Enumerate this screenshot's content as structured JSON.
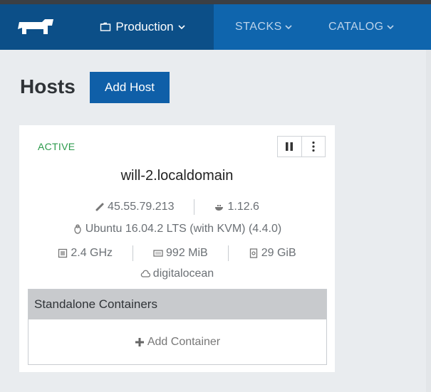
{
  "nav": {
    "environment": "Production",
    "items": [
      "STACKS",
      "CATALOG"
    ]
  },
  "page": {
    "title": "Hosts",
    "add_host_label": "Add Host"
  },
  "host": {
    "state": "ACTIVE",
    "name": "will-2.localdomain",
    "ip": "45.55.79.213",
    "docker_version": "1.12.6",
    "os": "Ubuntu 16.04.2 LTS (with KVM) (4.4.0)",
    "cpu": "2.4 GHz",
    "memory": "992 MiB",
    "storage": "29 GiB",
    "provider": "digitalocean"
  },
  "containers": {
    "header": "Standalone Containers",
    "add_label": "Add Container"
  },
  "colors": {
    "nav_bg": "#0f65ad",
    "nav_active_bg": "#0c4f88",
    "primary_button": "#0f5fa8",
    "active_status": "#2b9a4b"
  }
}
